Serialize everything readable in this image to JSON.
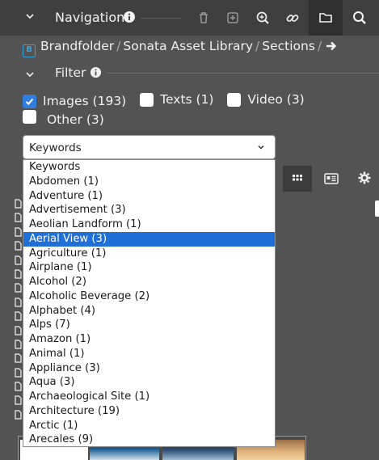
{
  "nav": {
    "title": "Navigation"
  },
  "breadcrumb": [
    "Brandfolder",
    "Sonata Asset Library",
    "Sections"
  ],
  "breadcrumb_separator": "/",
  "logo_letter": "B",
  "filter": {
    "title": "Filter"
  },
  "types": [
    {
      "label": "Images (193)",
      "checked": true
    },
    {
      "label": "Texts (1)",
      "checked": false
    },
    {
      "label": "Video (3)",
      "checked": false
    },
    {
      "label": "Other (3)",
      "checked": false
    }
  ],
  "select": {
    "value": "Keywords",
    "options": [
      "Keywords",
      "Abdomen (1)",
      "Adventure (1)",
      "Advertisement (3)",
      "Aeolian Landform (1)",
      "Aerial View (3)",
      "Agriculture (1)",
      "Airplane (1)",
      "Alcohol (2)",
      "Alcoholic Beverage (2)",
      "Alphabet (4)",
      "Alps (7)",
      "Amazon (1)",
      "Animal (1)",
      "Appliance (3)",
      "Aqua (3)",
      "Archaeological Site (1)",
      "Architecture (19)",
      "Arctic (1)",
      "Arecales (9)"
    ],
    "selected_option": "Aerial View (3)"
  },
  "colors": {
    "accent": "#2f7fe0",
    "selected_row": "#1f6fd9",
    "logo": "#3aa1d8",
    "panel": "#535353",
    "navbar": "#3f3f3f"
  }
}
